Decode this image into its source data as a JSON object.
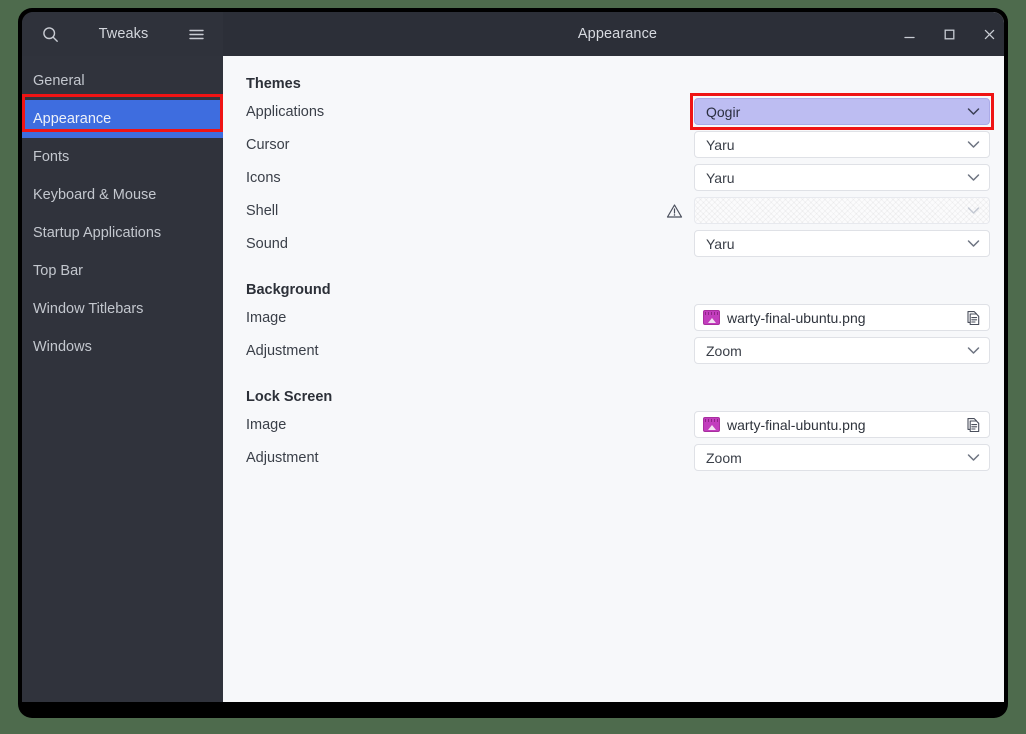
{
  "window": {
    "app_title": "Tweaks",
    "title": "Appearance",
    "search_icon": "search-icon",
    "menu_icon": "hamburger-menu-icon",
    "controls": [
      {
        "name": "minimize",
        "glyph": "minimize-icon"
      },
      {
        "name": "maximize",
        "glyph": "maximize-icon"
      },
      {
        "name": "close",
        "glyph": "close-icon"
      }
    ]
  },
  "sidebar": {
    "items": [
      {
        "label": "General",
        "selected": false
      },
      {
        "label": "Appearance",
        "selected": true
      },
      {
        "label": "Fonts",
        "selected": false
      },
      {
        "label": "Keyboard & Mouse",
        "selected": false
      },
      {
        "label": "Startup Applications",
        "selected": false
      },
      {
        "label": "Top Bar",
        "selected": false
      },
      {
        "label": "Window Titlebars",
        "selected": false
      },
      {
        "label": "Windows",
        "selected": false
      }
    ]
  },
  "main": {
    "groups": [
      {
        "title": "Themes",
        "rows": [
          {
            "label": "Applications",
            "control": "combo",
            "value": "Qogir",
            "state": "selected",
            "warning": false
          },
          {
            "label": "Cursor",
            "control": "combo",
            "value": "Yaru",
            "state": "normal",
            "warning": false
          },
          {
            "label": "Icons",
            "control": "combo",
            "value": "Yaru",
            "state": "normal",
            "warning": false
          },
          {
            "label": "Shell",
            "control": "combo",
            "value": "",
            "state": "disabled",
            "warning": true
          },
          {
            "label": "Sound",
            "control": "combo",
            "value": "Yaru",
            "state": "normal",
            "warning": false
          }
        ]
      },
      {
        "title": "Background",
        "rows": [
          {
            "label": "Image",
            "control": "file",
            "value": "warty-final-ubuntu.png",
            "state": "normal",
            "warning": false
          },
          {
            "label": "Adjustment",
            "control": "combo",
            "value": "Zoom",
            "state": "normal",
            "warning": false
          }
        ]
      },
      {
        "title": "Lock Screen",
        "rows": [
          {
            "label": "Image",
            "control": "file",
            "value": "warty-final-ubuntu.png",
            "state": "normal",
            "warning": false
          },
          {
            "label": "Adjustment",
            "control": "combo",
            "value": "Zoom",
            "state": "normal",
            "warning": false
          }
        ]
      }
    ]
  },
  "annotations": {
    "color": "#ef1414",
    "targets": [
      "sidebar-item-appearance",
      "applications-theme-combo"
    ]
  },
  "colors": {
    "sidebar_bg": "#30333c",
    "titlebar_bg": "#2c2f38",
    "content_bg": "#f7f8fa",
    "selection_blue": "#3e6ddf",
    "combo_selected": "#bdbdf2",
    "desktop_bg": "#4e6b4d"
  }
}
